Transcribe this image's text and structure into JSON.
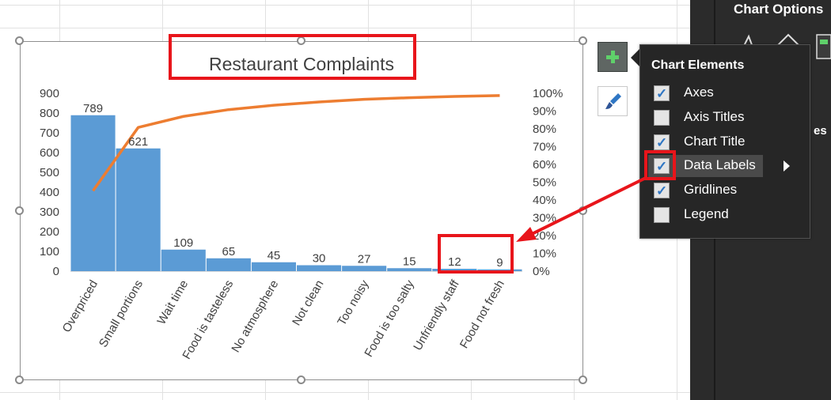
{
  "chart_data": {
    "type": "bar",
    "title": "Restaurant Complaints",
    "categories": [
      "Overpriced",
      "Small portions",
      "Wait time",
      "Food is tasteless",
      "No atmosphere",
      "Not clean",
      "Too noisy",
      "Food is too salty",
      "Unfriendly staff",
      "Food not fresh"
    ],
    "series": [
      {
        "type": "bar",
        "values": [
          789,
          621,
          109,
          65,
          45,
          30,
          27,
          15,
          12,
          9
        ]
      },
      {
        "type": "line",
        "axis": "secondary",
        "values": [
          45.2,
          80.8,
          87.0,
          90.8,
          93.3,
          95.1,
          96.6,
          97.5,
          98.2,
          98.7
        ]
      }
    ],
    "ylim": [
      0,
      900
    ],
    "yticks": [
      "0",
      "100",
      "200",
      "300",
      "400",
      "500",
      "600",
      "700",
      "800",
      "900"
    ],
    "y2lim": [
      0,
      100
    ],
    "y2ticks": [
      "0%",
      "10%",
      "20%",
      "30%",
      "40%",
      "50%",
      "60%",
      "70%",
      "80%",
      "90%",
      "100%"
    ],
    "grid": false,
    "legend": false,
    "data_labels": true,
    "colors": {
      "bar": "#5b9bd5",
      "line": "#ed7d31"
    }
  },
  "chart_toolbar": {
    "add_element_icon": "plus-icon",
    "styles_icon": "paintbrush-icon"
  },
  "side_panel": {
    "title": "Chart Options",
    "partial_text": "es"
  },
  "chart_elements_popup": {
    "title": "Chart Elements",
    "items": [
      {
        "label": "Axes",
        "checked": true
      },
      {
        "label": "Axis Titles",
        "checked": false
      },
      {
        "label": "Chart Title",
        "checked": true
      },
      {
        "label": "Data Labels",
        "checked": true
      },
      {
        "label": "Gridlines",
        "checked": true
      },
      {
        "label": "Legend",
        "checked": false
      }
    ],
    "submenu_icon": "chevron-right-icon"
  },
  "annotation": {
    "highlight_color": "#e8151b"
  }
}
